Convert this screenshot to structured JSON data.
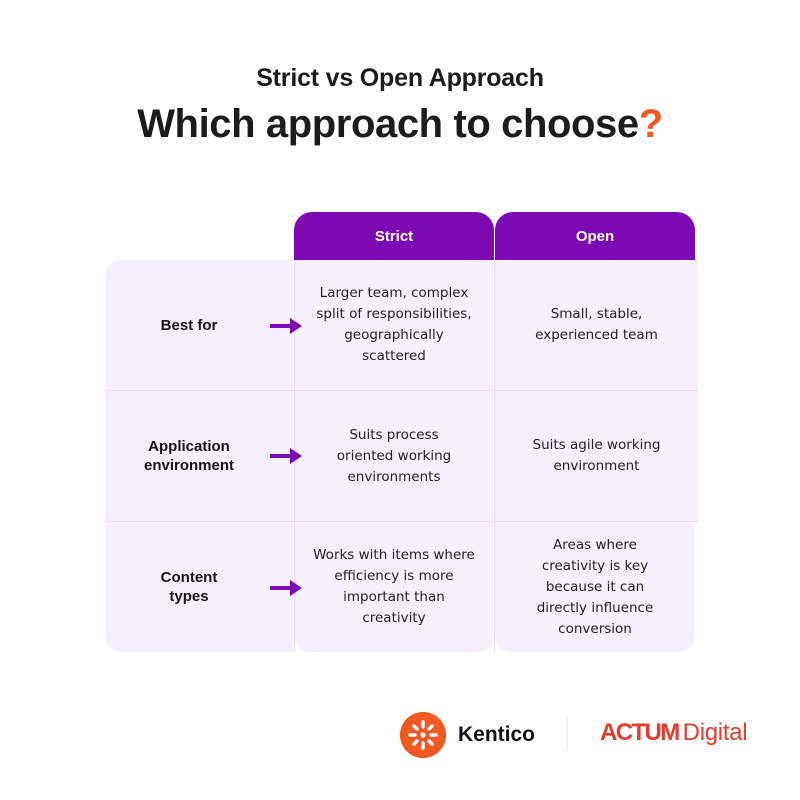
{
  "header": {
    "subtitle": "Strict vs Open Approach",
    "title": "Which approach to choose",
    "title_accent": "?"
  },
  "colors": {
    "accent_purple": "#7e0ab4",
    "cell_background": "#f5effe",
    "question_mark": "#f05a22",
    "kentico_orange": "#f05a22",
    "actum_red": "#e63c2e"
  },
  "table": {
    "columns": [
      "Strict",
      "Open"
    ],
    "rows": [
      {
        "label": "Best for",
        "strict": "Larger team, complex split of responsibilities, geographically scattered",
        "open": "Small, stable, experienced team"
      },
      {
        "label": "Application environment",
        "strict": "Suits process oriented working environments",
        "open": "Suits agile working environment"
      },
      {
        "label": "Content types",
        "strict": "Works with items where efficiency is more important than creativity",
        "open": "Areas where creativity is key because it can directly influence conversion"
      }
    ]
  },
  "footer": {
    "kentico": "Kentico",
    "actum_bold": "ACTUM",
    "actum_light": "Digital"
  }
}
